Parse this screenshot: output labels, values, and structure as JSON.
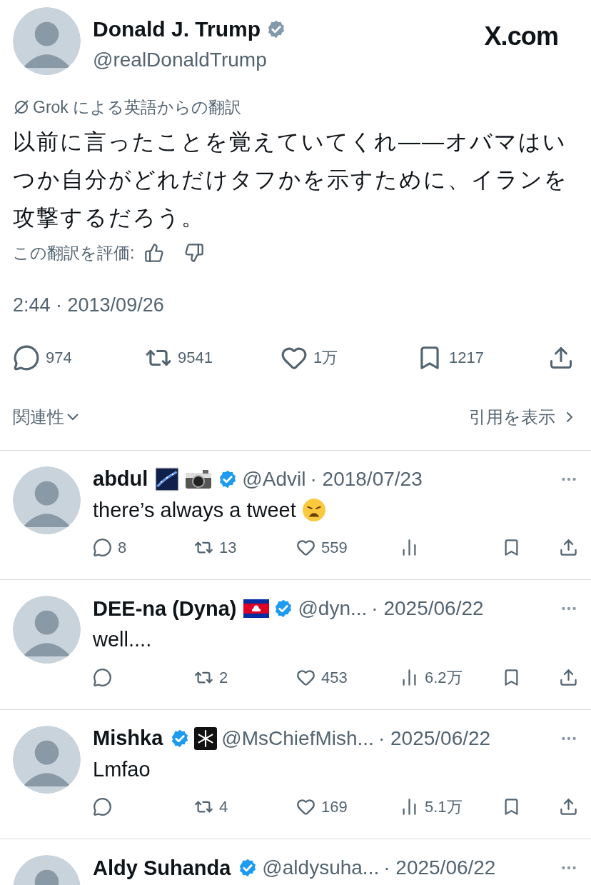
{
  "post": {
    "author": {
      "name": "Donald J. Trump",
      "handle": "@realDonaldTrump",
      "marks": [
        {
          "kind": "verified_gray"
        }
      ]
    },
    "site": "X.com",
    "translation_label": "Grok による英語からの翻訳",
    "body": "以前に言ったことを覚えていてくれ——オバマはいつか自分がどれだけタフかを示すために、イランを攻撃するだろう。",
    "rate_label": "この翻訳を評価:",
    "timestamp": "2:44 · 2013/09/26",
    "stats": {
      "replies": "974",
      "reposts": "9541",
      "likes": "1万",
      "bookmarks": "1217"
    }
  },
  "sort": {
    "label": "関連性"
  },
  "quotes_link": "引用を表示",
  "replies": [
    {
      "name": "abdul",
      "marks": [
        {
          "kind": "galaxy"
        },
        {
          "kind": "camera"
        },
        {
          "kind": "verified"
        }
      ],
      "handle": "@Advil",
      "date": "· 2018/07/23",
      "text": "there’s always a tweet",
      "text_marks": [
        {
          "kind": "weary"
        }
      ],
      "replies": "8",
      "reposts": "13",
      "likes": "559"
    },
    {
      "name": "DEE-na (Dyna)",
      "marks": [
        {
          "kind": "flag"
        },
        {
          "kind": "verified"
        }
      ],
      "handle": "@dyn...",
      "date": "· 2025/06/22",
      "text": "well....",
      "reposts": "2",
      "likes": "453",
      "views": "6.2万"
    },
    {
      "name": "Mishka",
      "marks": [
        {
          "kind": "verified"
        },
        {
          "kind": "snowflake"
        }
      ],
      "handle": "@MsChiefMish...",
      "date": "· 2025/06/22",
      "text": "Lmfao",
      "reposts": "4",
      "likes": "169",
      "views": "5.1万"
    },
    {
      "name": "Aldy Suhanda",
      "marks": [
        {
          "kind": "verified"
        }
      ],
      "handle": "@aldysuha...",
      "date": "· 2025/06/22"
    }
  ]
}
